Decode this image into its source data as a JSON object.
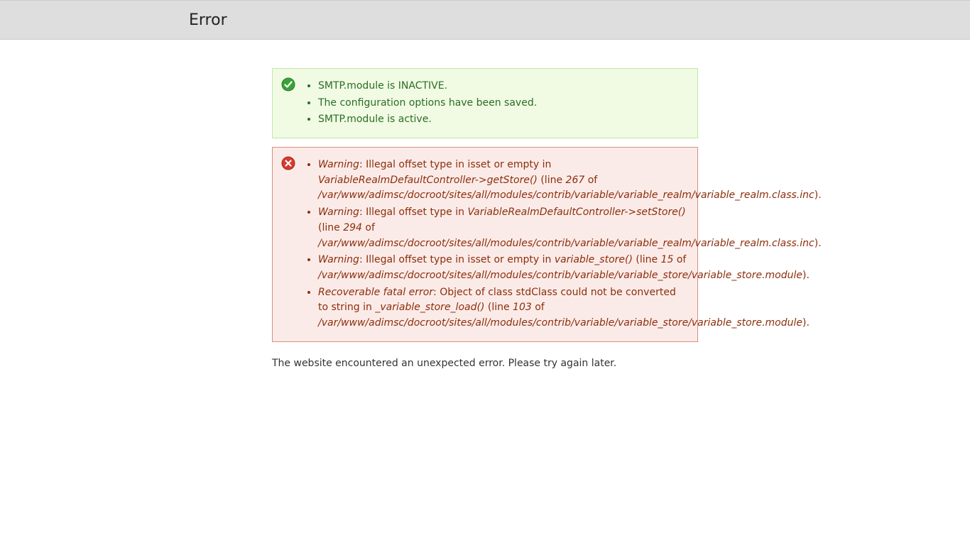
{
  "header": {
    "title": "Error"
  },
  "status_messages": [
    "SMTP.module is INACTIVE.",
    "The configuration options have been saved.",
    "SMTP.module is active."
  ],
  "error_messages": [
    {
      "type": "Warning",
      "text": ": Illegal offset type in isset or empty in ",
      "func": "VariableRealmDefaultController->getStore()",
      "mid": " (line ",
      "line": "267",
      "mid2": " of ",
      "path": "/var/www/adimsc/docroot/sites/all/modules/contrib/variable/variable_realm/variable_realm.class.inc",
      "end": ")."
    },
    {
      "type": "Warning",
      "text": ": Illegal offset type in ",
      "func": "VariableRealmDefaultController->setStore()",
      "mid": " (line ",
      "line": "294",
      "mid2": " of ",
      "path": "/var/www/adimsc/docroot/sites/all/modules/contrib/variable/variable_realm/variable_realm.class.inc",
      "end": ")."
    },
    {
      "type": "Warning",
      "text": ": Illegal offset type in isset or empty in ",
      "func": "variable_store()",
      "mid": " (line ",
      "line": "15",
      "mid2": " of ",
      "path": "/var/www/adimsc/docroot/sites/all/modules/contrib/variable/variable_store/variable_store.module",
      "end": ")."
    },
    {
      "type": "Recoverable fatal error",
      "text": ": Object of class stdClass could not be converted to string in ",
      "func": "_variable_store_load()",
      "mid": " (line ",
      "line": "103",
      "mid2": " of ",
      "path": "/var/www/adimsc/docroot/sites/all/modules/contrib/variable/variable_store/variable_store.module",
      "end": ")."
    }
  ],
  "footer": "The website encountered an unexpected error. Please try again later."
}
